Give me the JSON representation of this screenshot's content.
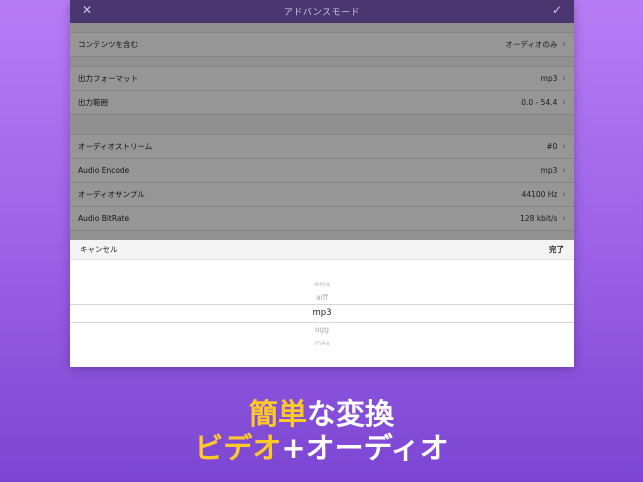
{
  "navbar": {
    "title": "アドバンスモード",
    "close_icon": "close-icon",
    "confirm_icon": "check-icon"
  },
  "settings": [
    {
      "label": "コンテンツを含む",
      "value": "オーディオのみ"
    },
    {
      "label": "出力フォーマット",
      "value": "mp3"
    },
    {
      "label": "出力範囲",
      "value": "0.0 - 54.4"
    },
    {
      "label": "オーディオストリーム",
      "value": "#0"
    },
    {
      "label": "Audio Encode",
      "value": "mp3"
    },
    {
      "label": "オーディオサンプル",
      "value": "44100 Hz"
    },
    {
      "label": "Audio BitRate",
      "value": "128 kbit/s"
    }
  ],
  "picker": {
    "cancel_label": "キャンセル",
    "done_label": "完了",
    "options": [
      "wma",
      "aiff",
      "mp3",
      "ogg",
      "m4a"
    ],
    "selected": "mp3"
  },
  "caption": {
    "line1_highlight": "簡単",
    "line1_rest": "な変換",
    "line2_highlight": "ビデオ",
    "line2_rest": "+オーディオ"
  },
  "colors": {
    "accent": "#fcc82a",
    "navbar": "#4a3670",
    "background_top": "#b77cf5",
    "background_bottom": "#7b46d2"
  }
}
